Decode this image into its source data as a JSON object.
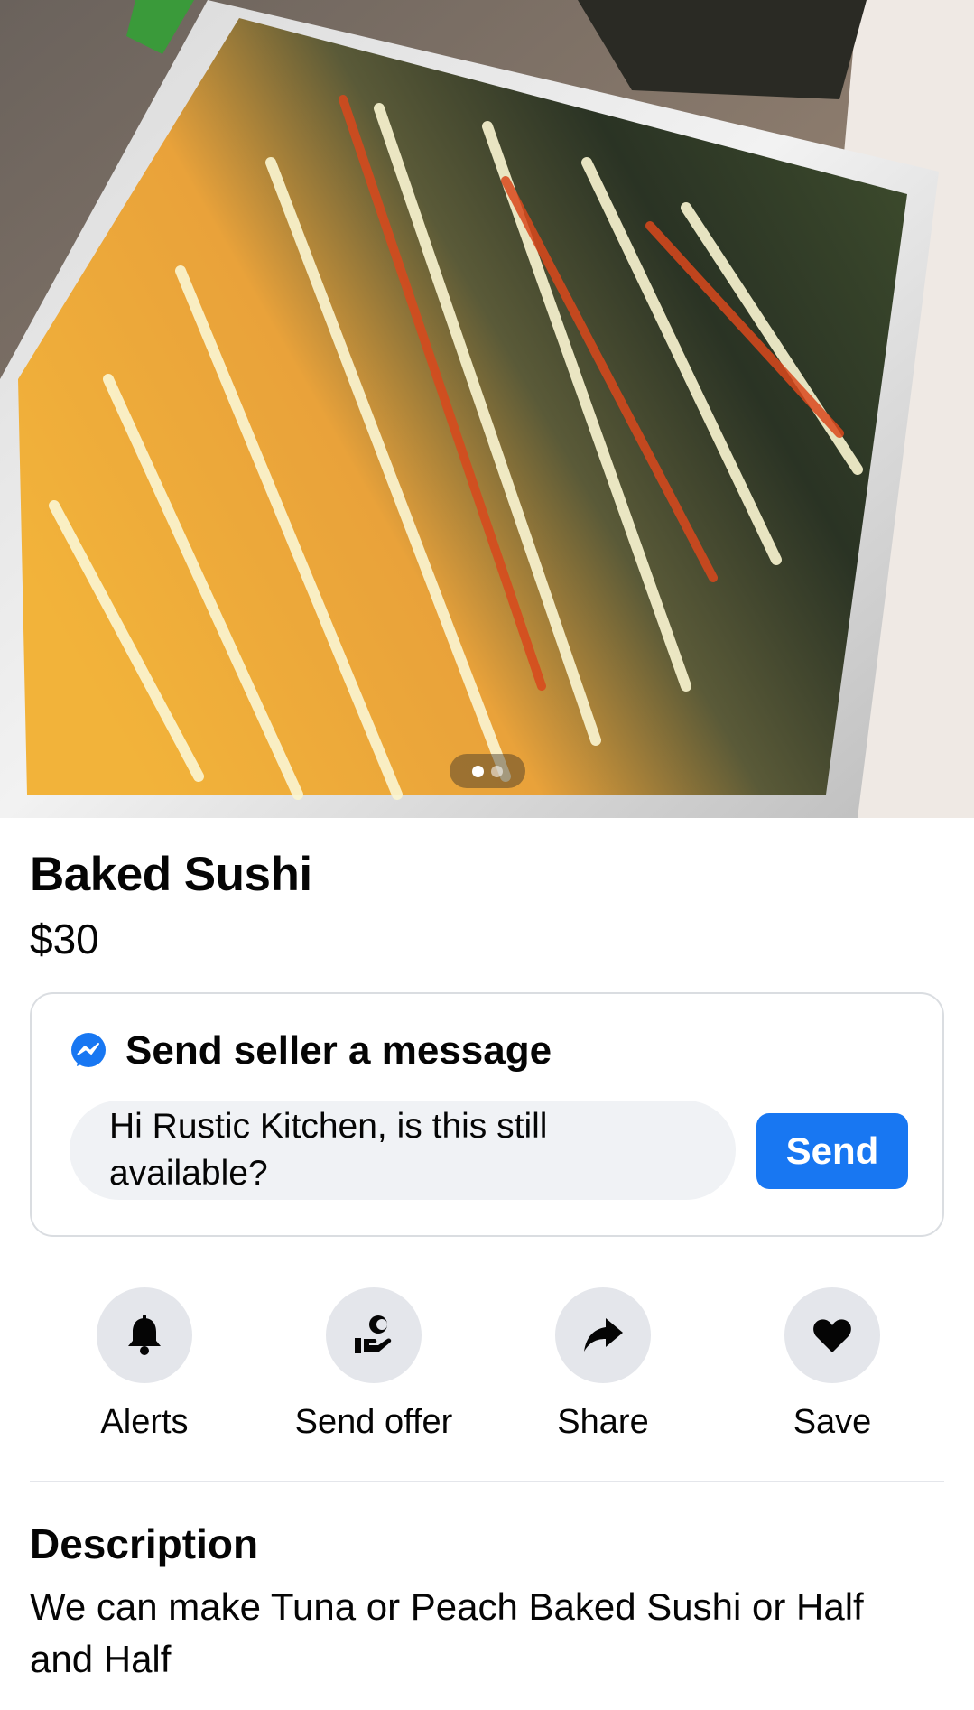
{
  "listing": {
    "title": "Baked Sushi",
    "price": "$30",
    "photo": {
      "description_icon": "food-photo",
      "page_count": 2,
      "active_page": 1
    }
  },
  "message": {
    "header": "Send seller a message",
    "input_value": "Hi Rustic Kitchen, is this still available?",
    "send_label": "Send",
    "icon": "messenger-icon"
  },
  "actions": [
    {
      "label": "Alerts",
      "icon": "bell-icon"
    },
    {
      "label": "Send offer",
      "icon": "offer-hand-icon"
    },
    {
      "label": "Share",
      "icon": "share-arrow-icon"
    },
    {
      "label": "Save",
      "icon": "heart-icon"
    }
  ],
  "description": {
    "heading": "Description",
    "body": "We can make Tuna or Peach Baked Sushi or Half and Half"
  },
  "colors": {
    "accent": "#1877f2",
    "input_bg": "#f0f2f5",
    "action_bg": "#e4e6eb"
  }
}
